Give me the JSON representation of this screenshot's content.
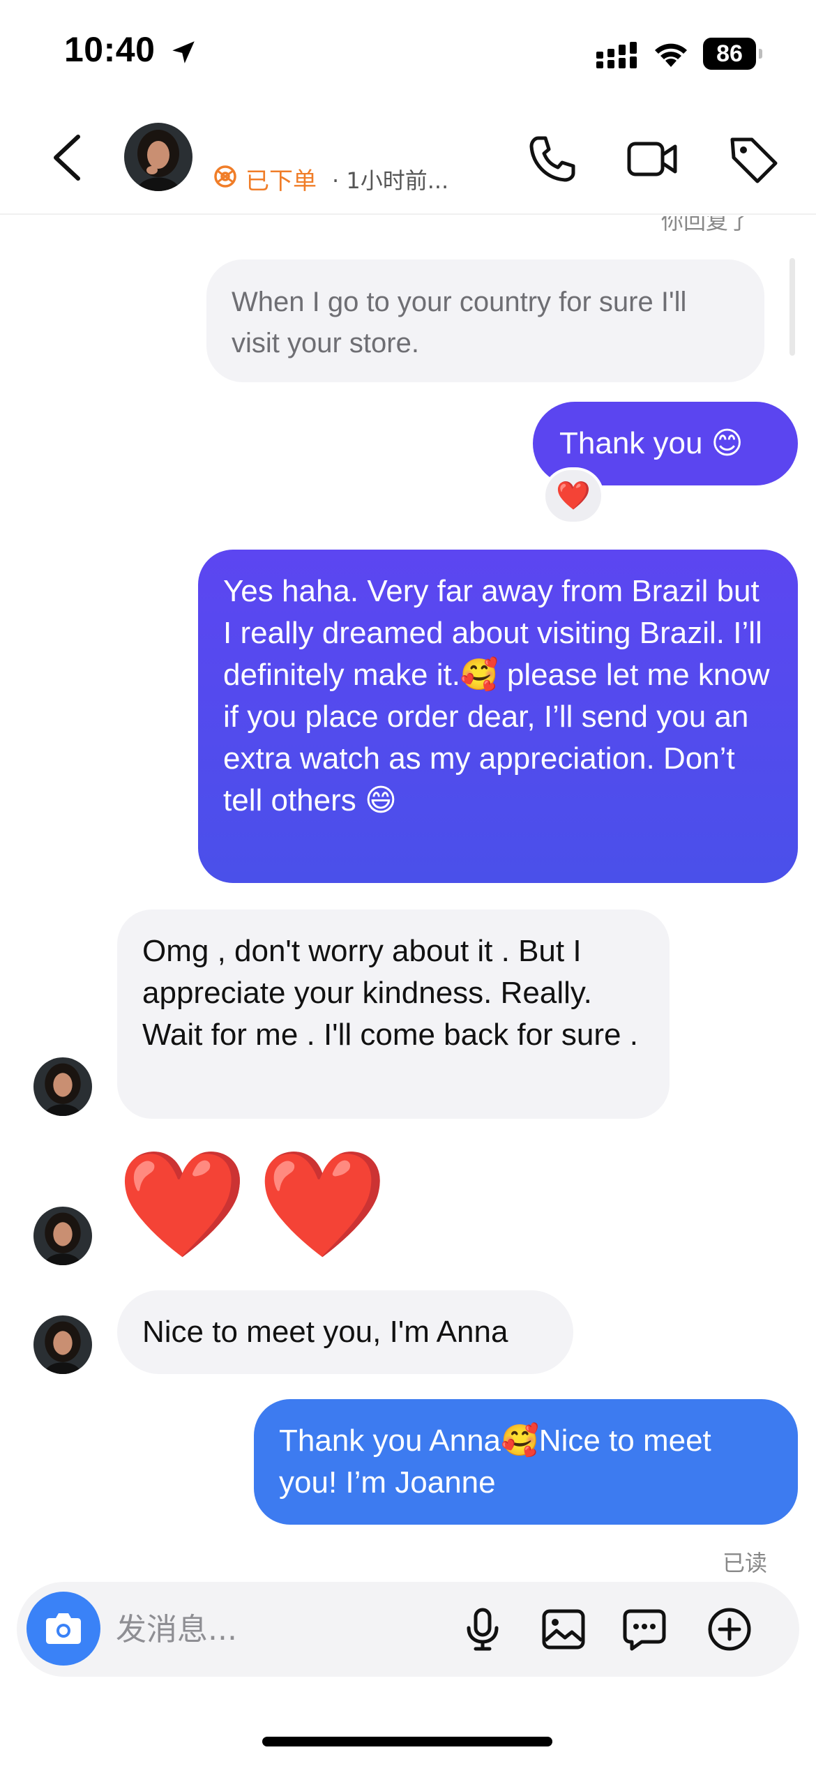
{
  "status_bar": {
    "time": "10:40",
    "battery": "86"
  },
  "header": {
    "order_status": "已下单",
    "last_seen": "· 1小时前...",
    "icons": [
      "back-icon",
      "phone-icon",
      "video-icon",
      "tag-icon"
    ]
  },
  "chat": {
    "partial_top_text": "你回复了",
    "quoted_message": "When I go to your country for sure I'll visit your store.",
    "messages": [
      {
        "side": "out",
        "text": "Thank you 😊",
        "reaction": "❤️"
      },
      {
        "side": "out",
        "text": "Yes haha. Very far away from Brazil but I really dreamed about visiting Brazil. I’ll definitely make it.🥰 please let me know if you place order dear, I’ll send you an extra watch as my appreciation. Don’t tell others 😄"
      },
      {
        "side": "in",
        "text": "Omg , don't worry about it . But I appreciate your kindness. Really. Wait for me . I'll come back for sure ."
      },
      {
        "side": "in",
        "text": "❤️❤️"
      },
      {
        "side": "in",
        "text": "Nice to meet you, I'm Anna"
      },
      {
        "side": "out",
        "text": "Thank you Anna🥰Nice to meet you! I’m Joanne"
      }
    ],
    "read_status": "已读"
  },
  "composer": {
    "placeholder": "发消息..."
  },
  "colors": {
    "outgoing_purple": "#5b45f0",
    "outgoing_blue": "#3d7bf0",
    "incoming_gray": "#f3f3f6",
    "order_orange": "#f07d28",
    "camera_blue": "#3a82f7"
  }
}
